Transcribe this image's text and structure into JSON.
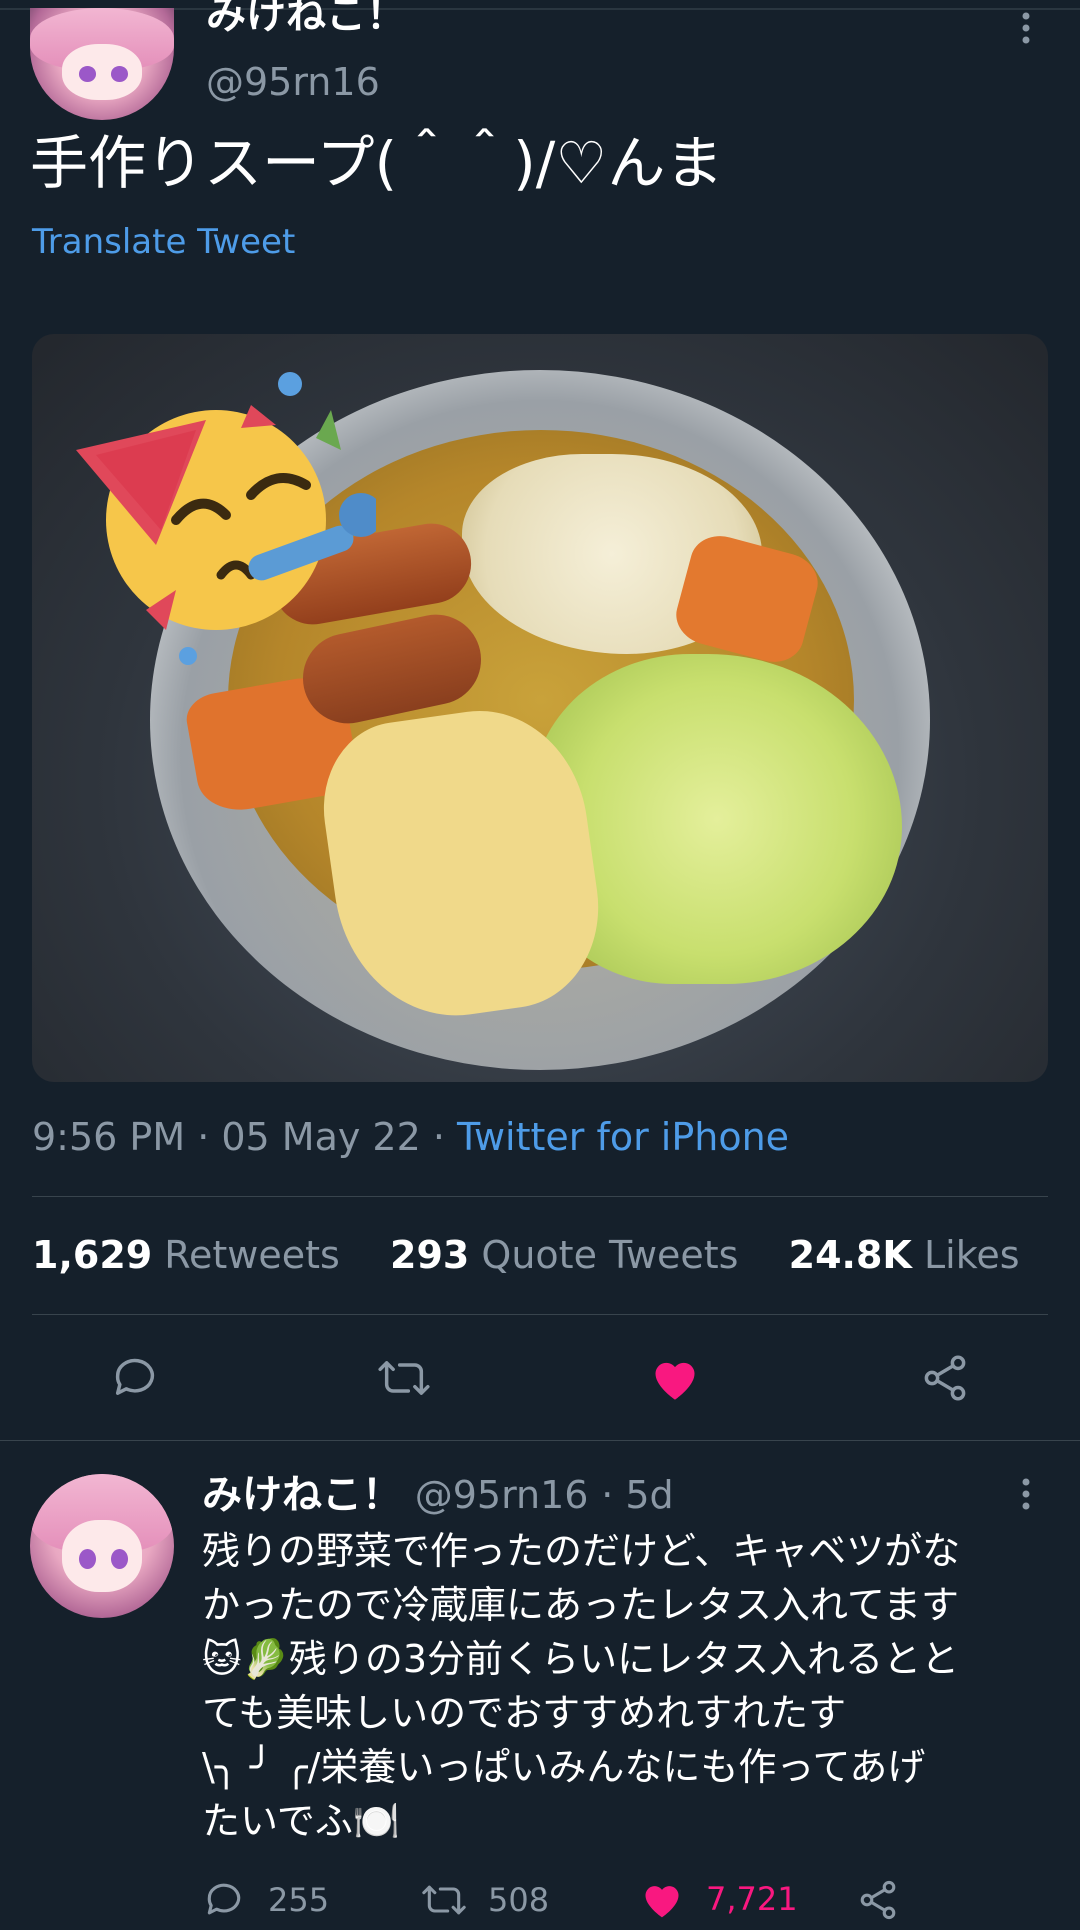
{
  "tweet": {
    "author_name": "みけねこ！",
    "author_handle": "@95rn16",
    "text": "手作りスープ(＾＾)/♡んま",
    "translate_label": "Translate Tweet",
    "time": "9:56 PM · 05 May 22 · ",
    "source": "Twitter for iPhone",
    "stats": {
      "retweets_count": "1,629",
      "retweets_label": "Retweets",
      "quotes_count": "293",
      "quotes_label": "Quote Tweets",
      "likes_count": "24.8K",
      "likes_label": "Likes"
    }
  },
  "reply": {
    "author_name": "みけねこ！",
    "author_handle": "@95rn16",
    "age": "· 5d",
    "lines": [
      "残りの野菜で作ったのだけど、キャベツがな",
      "かったので冷蔵庫にあったレタス入れてます",
      "🐱🥬残りの3分前くらいにレタス入れるとと",
      "ても美味しいのでおすすめれすれたす",
      "\\╮ ╯  ╭/栄養いっぱいみんなにも作ってあげ",
      "たいでふ🍽️"
    ],
    "counts": {
      "replies": "255",
      "retweets": "508",
      "likes": "7,721"
    }
  },
  "colors": {
    "background": "#15202b",
    "accent": "#4e9ce8",
    "like": "#f91880",
    "muted": "#8b98a5"
  },
  "icons": [
    "more-icon",
    "reply-icon",
    "retweet-icon",
    "heart-icon",
    "share-icon"
  ]
}
